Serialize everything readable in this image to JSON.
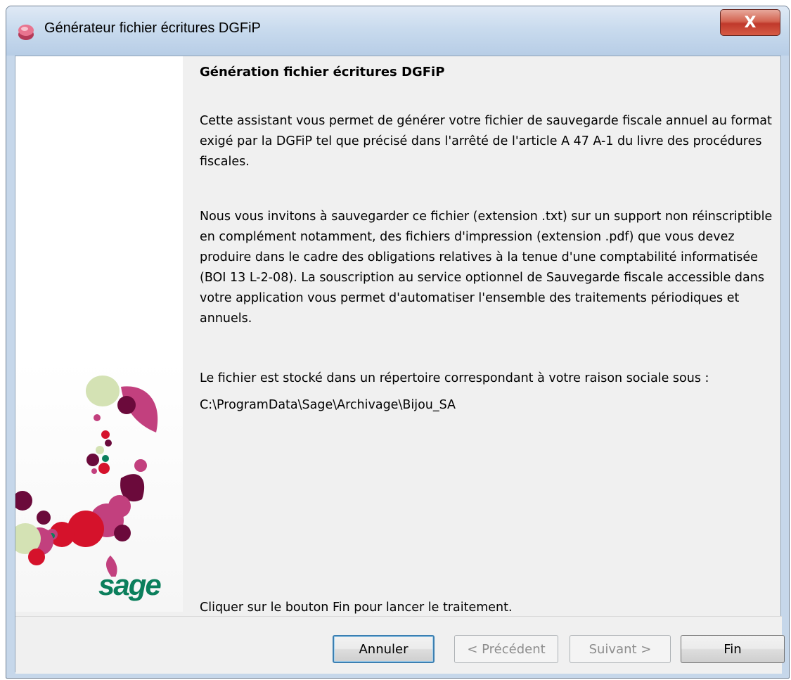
{
  "window": {
    "title": "Générateur fichier écritures DGFiP",
    "close_label": "X"
  },
  "side_panel": {
    "logo_text": "sage"
  },
  "content": {
    "heading": "Génération fichier écritures DGFiP",
    "paragraph1": "Cette assistant vous permet de générer votre fichier de sauvegarde fiscale annuel au format exigé par la DGFiP tel que précisé dans l'arrêté de l'article A 47 A-1 du livre des procédures fiscales.",
    "paragraph2": "Nous vous invitons à sauvegarder ce fichier (extension .txt) sur un support non réinscriptible en complément notamment, des fichiers d'impression (extension .pdf) que vous devez produire dans le cadre des obligations relatives à la tenue d'une comptabilité informatisée (BOI 13 L-2-08). La souscription au service optionnel de Sauvegarde fiscale accessible dans votre application vous permet d'automatiser l'ensemble des traitements périodiques et annuels.",
    "paragraph3": "Le fichier est stocké dans un répertoire correspondant à votre raison sociale sous :",
    "path": "C:\\ProgramData\\Sage\\Archivage\\Bijou_SA",
    "instruction": "Cliquer sur le bouton Fin pour lancer le traitement."
  },
  "buttons": {
    "cancel": "Annuler",
    "previous": "< Précédent",
    "next": "Suivant >",
    "finish": "Fin"
  },
  "colors": {
    "brand_green": "#0b7f5c",
    "magenta": "#c2407e",
    "plum": "#6b0a3b",
    "red": "#d5122b",
    "pale_green": "#d4e2b4"
  }
}
